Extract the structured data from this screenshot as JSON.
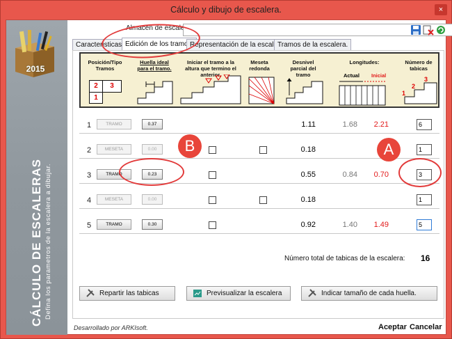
{
  "window": {
    "title": "Cálculo y dibujo de escalera.",
    "close_glyph": "×"
  },
  "sidebar": {
    "box_year": "2015",
    "title": "CÁLCULO DE ESCALERAS",
    "subtitle": "Defina los parametros de la escalera a dibujar."
  },
  "store": {
    "label": "Almacén de escaleras:",
    "value": "",
    "arrow": "⌄"
  },
  "tabs": [
    "Caracteristicas.",
    "Edición de los tramos.",
    "Representación de la escalera.",
    "Tramos de la escalera."
  ],
  "header": {
    "col1": "Posición/Tipo Tramos",
    "col2": "Huella ideal para el tramo.",
    "col3": "Iniciar el tramo a la altura que termino el anterior.",
    "col4": "Meseta redonda",
    "col5": "Desnivel parcial del tramo",
    "col6": "Longitudes:",
    "col6a": "Actual",
    "col6b": "Inicial",
    "col7": "Número de tabicas",
    "pos_digits": [
      "2",
      "3",
      "1"
    ],
    "tab_digits": [
      "3",
      "2",
      "1"
    ]
  },
  "rows": [
    {
      "n": "1",
      "type": "TRAMO",
      "huella": "0.37",
      "desnivel": "1.11",
      "actual": "1.68",
      "inicial": "2.21",
      "tabicas": "6"
    },
    {
      "n": "2",
      "type": "MESETA",
      "huella": "0.00",
      "desnivel": "0.18",
      "actual": "",
      "inicial": "",
      "tabicas": "1"
    },
    {
      "n": "3",
      "type": "TRAMO",
      "huella": "0.23",
      "desnivel": "0.55",
      "actual": "0.84",
      "inicial": "0.70",
      "tabicas": "3"
    },
    {
      "n": "4",
      "type": "MESETA",
      "huella": "0.00",
      "desnivel": "0.18",
      "actual": "",
      "inicial": "",
      "tabicas": "1"
    },
    {
      "n": "5",
      "type": "TRAMO",
      "huella": "0.30",
      "desnivel": "0.92",
      "actual": "1.40",
      "inicial": "1.49",
      "tabicas": "5"
    }
  ],
  "total": {
    "label": "Número total de tabicas de la escalera:",
    "value": "16"
  },
  "buttons": {
    "repartir": "Repartir las tabicas",
    "previsualizar": "Previsualizar la escalera",
    "indicar": "Indicar tamaño de cada huella."
  },
  "footer": {
    "credit": "Desarrollado por ARKIsoft.",
    "accept": "Aceptar",
    "cancel": "Cancelar"
  },
  "annotations": {
    "a": "A",
    "b": "B"
  },
  "colors": {
    "window": "#e8574c",
    "annotation": "#e23a3a",
    "inicial": "#e21a1a"
  }
}
